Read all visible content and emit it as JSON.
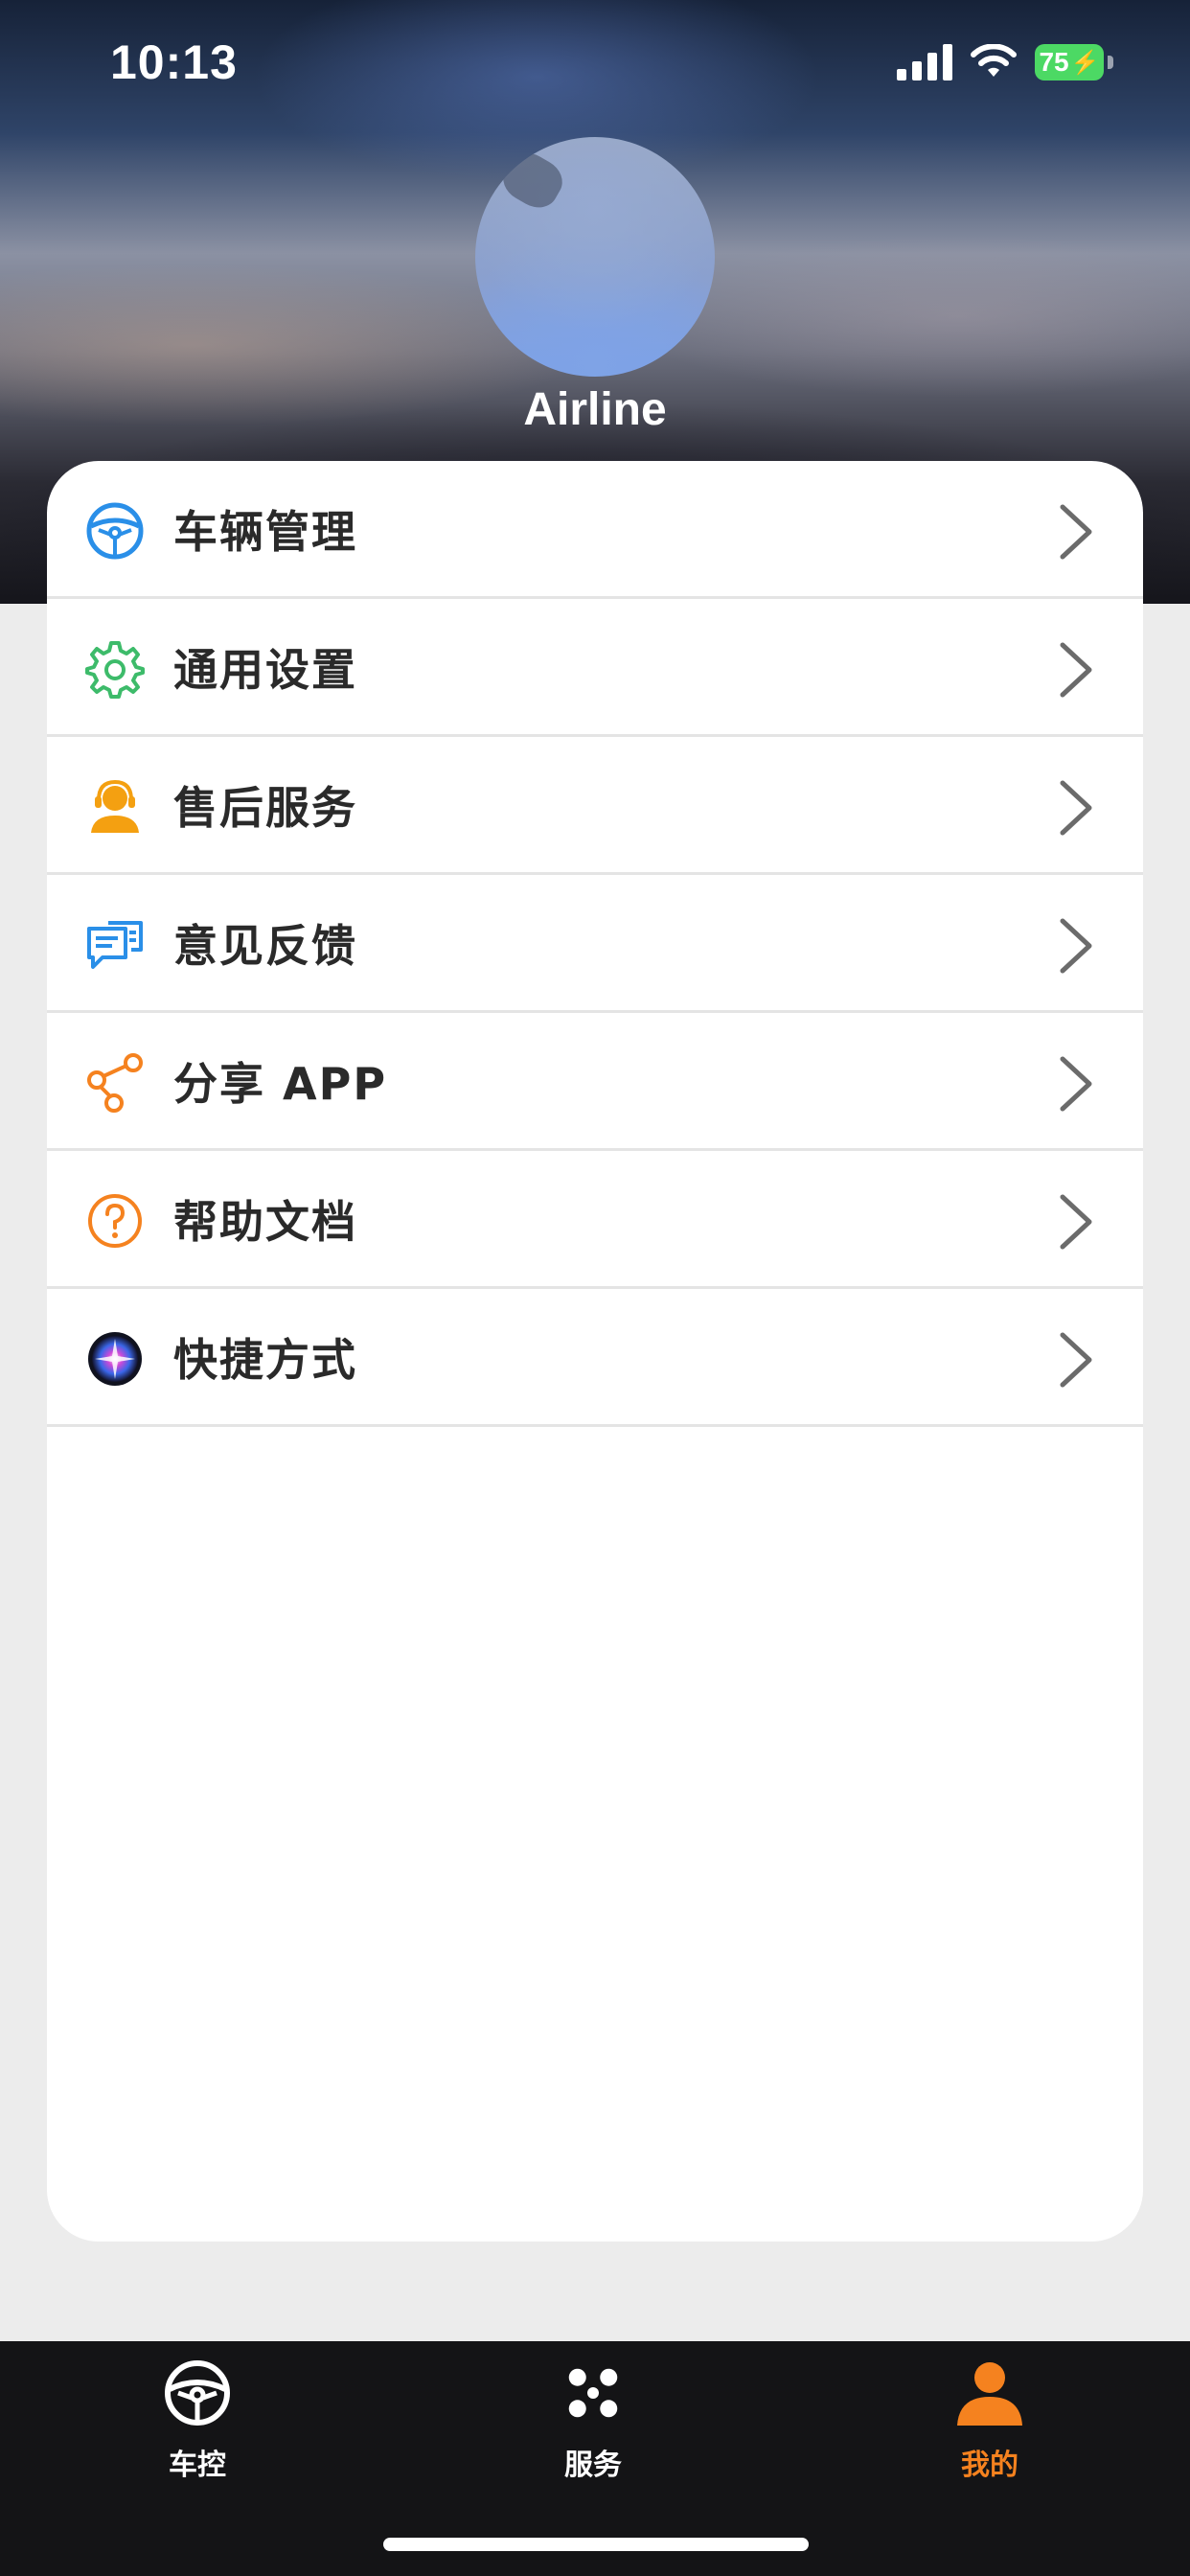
{
  "status_bar": {
    "time": "10:13",
    "battery": "75",
    "icons": [
      "cellular-signal-icon",
      "wifi-icon",
      "battery-charging-icon"
    ]
  },
  "profile": {
    "username": "Airline"
  },
  "menu": {
    "items": [
      {
        "label": "车辆管理",
        "icon": "steering-wheel-icon",
        "color": "#2a8fe8"
      },
      {
        "label": "通用设置",
        "icon": "gear-icon",
        "color": "#3dbb6a"
      },
      {
        "label": "售后服务",
        "icon": "customer-service-icon",
        "color": "#f4a011"
      },
      {
        "label": "意见反馈",
        "icon": "feedback-chat-icon",
        "color": "#2a8fe8"
      },
      {
        "label": "分享 APP",
        "icon": "share-icon",
        "color": "#f5821f"
      },
      {
        "label": "帮助文档",
        "icon": "help-question-icon",
        "color": "#f5821f"
      },
      {
        "label": "快捷方式",
        "icon": "siri-shortcut-icon",
        "color": "#5a3fd0"
      }
    ]
  },
  "tabbar": {
    "tabs": [
      {
        "label": "车控",
        "icon": "steering-wheel-icon",
        "active": false
      },
      {
        "label": "服务",
        "icon": "clover-grid-icon",
        "active": false
      },
      {
        "label": "我的",
        "icon": "person-icon",
        "active": true
      }
    ],
    "active_color": "#f5821f"
  }
}
